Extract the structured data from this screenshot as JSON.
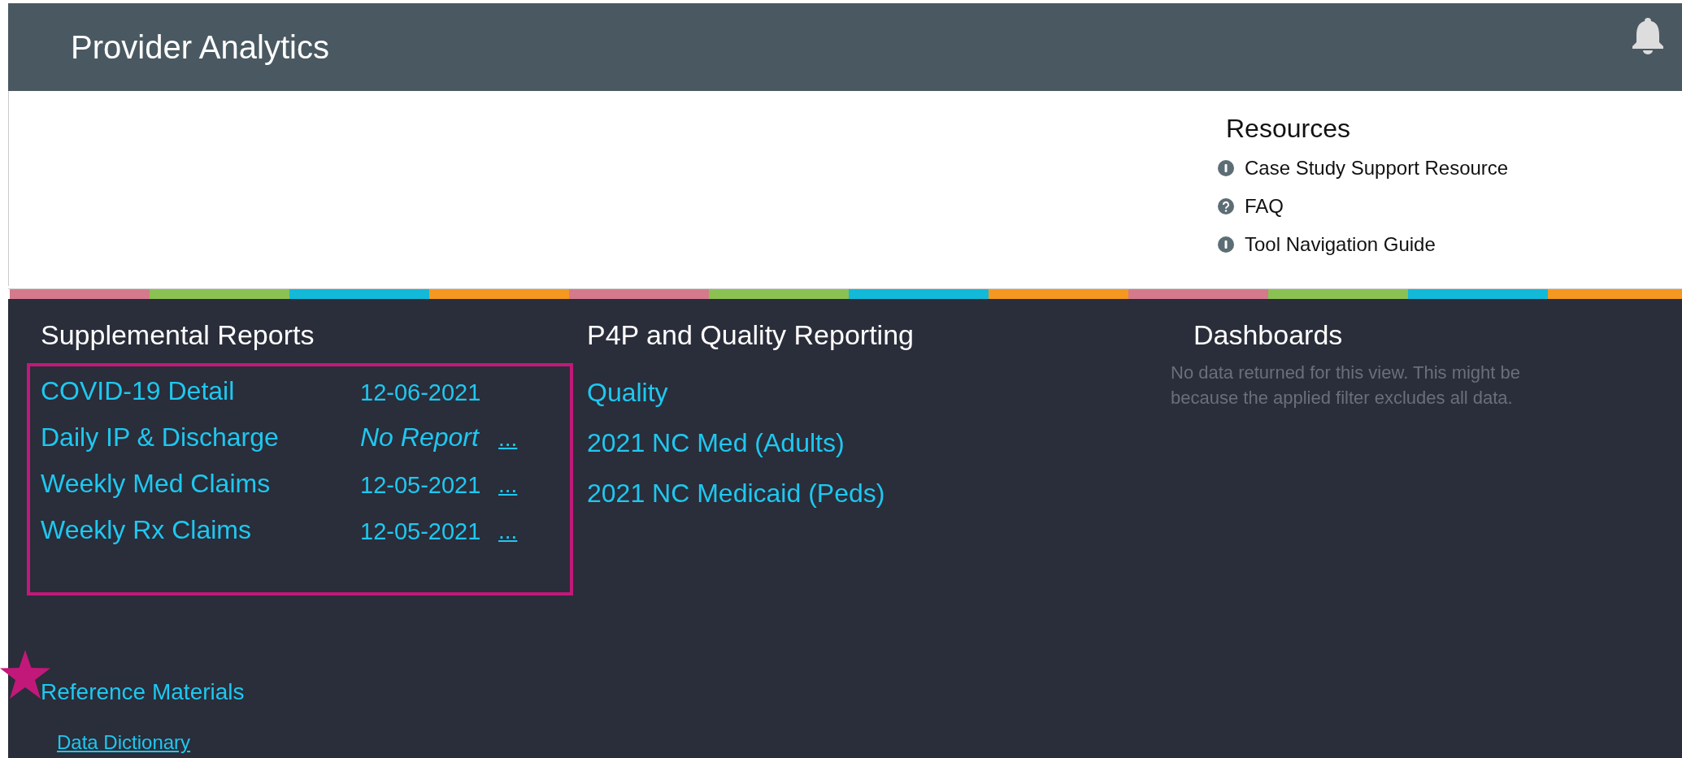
{
  "header": {
    "title": "Provider Analytics"
  },
  "resources": {
    "title": "Resources",
    "items": [
      {
        "label": "Case Study Support Resource",
        "kind": "info"
      },
      {
        "label": "FAQ",
        "kind": "help"
      },
      {
        "label": "Tool Navigation Guide",
        "kind": "info"
      }
    ]
  },
  "supplemental_reports": {
    "title": "Supplemental Reports",
    "rows": [
      {
        "name": "COVID-19 Detail",
        "date": "12-06-2021",
        "kind": "date"
      },
      {
        "name": "Daily IP & Discharge",
        "date": "No Report",
        "kind": "no_report",
        "more": "..."
      },
      {
        "name": "Weekly Med Claims",
        "date": "12-05-2021",
        "kind": "date",
        "more": "..."
      },
      {
        "name": "Weekly Rx Claims",
        "date": "12-05-2021",
        "kind": "date",
        "more": "..."
      }
    ]
  },
  "p4p_quality_reporting": {
    "title": "P4P and Quality Reporting",
    "items": [
      "Quality",
      "2021 NC Med (Adults)",
      "2021 NC Medicaid (Peds)"
    ]
  },
  "dashboards": {
    "title": "Dashboards",
    "message": "No data returned for this view. This might be because the applied filter excludes all data."
  },
  "reference_materials": {
    "title": "Reference Materials",
    "links": [
      "Data Dictionary"
    ]
  }
}
